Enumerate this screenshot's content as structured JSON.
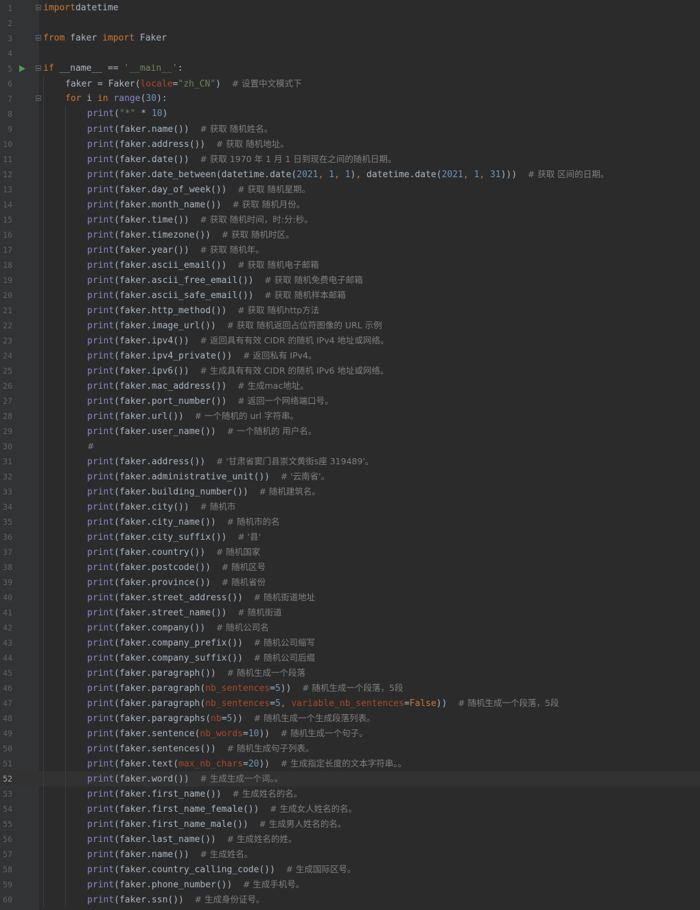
{
  "editor": {
    "current_line": 52,
    "run_marker_line": 5,
    "fold_lines": [
      1,
      3,
      5,
      7
    ],
    "colors": {
      "background": "#2b2b2b",
      "gutter": "#313335",
      "keyword": "#cc7832",
      "string": "#6a8759",
      "number": "#6897bb",
      "builtin": "#8888c6",
      "parameter": "#aa4926",
      "comment": "#808080",
      "text": "#a9b7c6",
      "run_marker": "#499c54"
    },
    "lines": [
      {
        "n": 1,
        "i": 0,
        "t": [
          [
            "kw",
            "import"
          ],
          [
            "",
            "datetime"
          ]
        ],
        "sp": [
          0,
          1
        ]
      },
      {
        "n": 2,
        "i": 0,
        "t": []
      },
      {
        "n": 3,
        "i": 0,
        "t": [
          [
            "kw",
            "from"
          ],
          [
            "",
            " faker "
          ],
          [
            "kw",
            "import"
          ],
          [
            "",
            " Faker"
          ]
        ]
      },
      {
        "n": 4,
        "i": 0,
        "t": []
      },
      {
        "n": 5,
        "i": 0,
        "t": [
          [
            "kw",
            "if"
          ],
          [
            "",
            " __name__ == "
          ],
          [
            "str",
            "'__main__'"
          ],
          [
            "",
            ":"
          ]
        ]
      },
      {
        "n": 6,
        "i": 1,
        "t": [
          [
            "",
            "faker = Faker("
          ],
          [
            "par",
            "locale"
          ],
          [
            "",
            "="
          ],
          [
            "str",
            "\"zh_CN\""
          ],
          [
            "",
            ")  "
          ],
          [
            "cm",
            "# 设置中文模式下"
          ]
        ]
      },
      {
        "n": 7,
        "i": 1,
        "t": [
          [
            "kw",
            "for"
          ],
          [
            "",
            " i "
          ],
          [
            "kw",
            "in"
          ],
          [
            "",
            " "
          ],
          [
            "bi",
            "range"
          ],
          [
            "",
            "("
          ],
          [
            "num",
            "30"
          ],
          [
            "",
            "):"
          ]
        ]
      },
      {
        "n": 8,
        "i": 2,
        "t": [
          [
            "bi",
            "print"
          ],
          [
            "",
            "("
          ],
          [
            "str",
            "\"*\""
          ],
          [
            "",
            " * "
          ],
          [
            "num",
            "10"
          ],
          [
            "",
            ")"
          ]
        ]
      },
      {
        "n": 9,
        "i": 2,
        "t": [
          [
            "bi",
            "print"
          ],
          [
            "",
            "(faker.name())  "
          ],
          [
            "cm",
            "# 获取 随机姓名。"
          ]
        ]
      },
      {
        "n": 10,
        "i": 2,
        "t": [
          [
            "bi",
            "print"
          ],
          [
            "",
            "(faker.address())  "
          ],
          [
            "cm",
            "# 获取 随机地址。"
          ]
        ]
      },
      {
        "n": 11,
        "i": 2,
        "t": [
          [
            "bi",
            "print"
          ],
          [
            "",
            "(faker.date())  "
          ],
          [
            "cm",
            "# 获取 1970 年 1 月 1 日到现在之间的随机日期。"
          ]
        ]
      },
      {
        "n": 12,
        "i": 2,
        "t": [
          [
            "bi",
            "print"
          ],
          [
            "",
            "(faker.date_between(datetime.date("
          ],
          [
            "num",
            "2021"
          ],
          [
            "kw",
            ", "
          ],
          [
            "num",
            "1"
          ],
          [
            "kw",
            ", "
          ],
          [
            "num",
            "1"
          ],
          [
            "",
            ")"
          ],
          [
            "kw",
            ", "
          ],
          [
            "",
            "datetime.date("
          ],
          [
            "num",
            "2021"
          ],
          [
            "kw",
            ", "
          ],
          [
            "num",
            "1"
          ],
          [
            "kw",
            ", "
          ],
          [
            "num",
            "31"
          ],
          [
            "",
            ")))  "
          ],
          [
            "cm",
            "# 获取 区间的日期。"
          ]
        ]
      },
      {
        "n": 13,
        "i": 2,
        "t": [
          [
            "bi",
            "print"
          ],
          [
            "",
            "(faker.day_of_week())  "
          ],
          [
            "cm",
            "# 获取 随机星期。"
          ]
        ]
      },
      {
        "n": 14,
        "i": 2,
        "t": [
          [
            "bi",
            "print"
          ],
          [
            "",
            "(faker.month_name())  "
          ],
          [
            "cm",
            "# 获取 随机月份。"
          ]
        ]
      },
      {
        "n": 15,
        "i": 2,
        "t": [
          [
            "bi",
            "print"
          ],
          [
            "",
            "(faker.time())  "
          ],
          [
            "cm",
            "# 获取 随机时间，时:分:秒。"
          ]
        ]
      },
      {
        "n": 16,
        "i": 2,
        "t": [
          [
            "bi",
            "print"
          ],
          [
            "",
            "(faker.timezone())  "
          ],
          [
            "cm",
            "# 获取 随机时区。"
          ]
        ]
      },
      {
        "n": 17,
        "i": 2,
        "t": [
          [
            "bi",
            "print"
          ],
          [
            "",
            "(faker.year())  "
          ],
          [
            "cm",
            "# 获取 随机年。"
          ]
        ]
      },
      {
        "n": 18,
        "i": 2,
        "t": [
          [
            "bi",
            "print"
          ],
          [
            "",
            "(faker.ascii_email())  "
          ],
          [
            "cm",
            "# 获取 随机电子邮箱"
          ]
        ]
      },
      {
        "n": 19,
        "i": 2,
        "t": [
          [
            "bi",
            "print"
          ],
          [
            "",
            "(faker.ascii_free_email())  "
          ],
          [
            "cm",
            "# 获取 随机免费电子邮箱"
          ]
        ]
      },
      {
        "n": 20,
        "i": 2,
        "t": [
          [
            "bi",
            "print"
          ],
          [
            "",
            "(faker.ascii_safe_email())  "
          ],
          [
            "cm",
            "# 获取 随机样本邮箱"
          ]
        ]
      },
      {
        "n": 21,
        "i": 2,
        "t": [
          [
            "bi",
            "print"
          ],
          [
            "",
            "(faker.http_method())  "
          ],
          [
            "cm",
            "# 获取 随机http方法"
          ]
        ]
      },
      {
        "n": 22,
        "i": 2,
        "t": [
          [
            "bi",
            "print"
          ],
          [
            "",
            "(faker.image_url())  "
          ],
          [
            "cm",
            "# 获取 随机返回占位符图像的 URL 示例"
          ]
        ]
      },
      {
        "n": 23,
        "i": 2,
        "t": [
          [
            "bi",
            "print"
          ],
          [
            "",
            "(faker.ipv4())  "
          ],
          [
            "cm",
            "# 返回具有有效 CIDR 的随机 IPv4 地址或网络。"
          ]
        ]
      },
      {
        "n": 24,
        "i": 2,
        "t": [
          [
            "bi",
            "print"
          ],
          [
            "",
            "(faker.ipv4_private())  "
          ],
          [
            "cm",
            "# 返回私有 IPv4。"
          ]
        ]
      },
      {
        "n": 25,
        "i": 2,
        "t": [
          [
            "bi",
            "print"
          ],
          [
            "",
            "(faker.ipv6())  "
          ],
          [
            "cm",
            "# 生成具有有效 CIDR 的随机 IPv6 地址或网络。"
          ]
        ]
      },
      {
        "n": 26,
        "i": 2,
        "t": [
          [
            "bi",
            "print"
          ],
          [
            "",
            "(faker.mac_address())  "
          ],
          [
            "cm",
            "# 生成mac地址。"
          ]
        ]
      },
      {
        "n": 27,
        "i": 2,
        "t": [
          [
            "bi",
            "print"
          ],
          [
            "",
            "(faker.port_number())  "
          ],
          [
            "cm",
            "# 返回一个网络端口号。"
          ]
        ]
      },
      {
        "n": 28,
        "i": 2,
        "t": [
          [
            "bi",
            "print"
          ],
          [
            "",
            "(faker.url())  "
          ],
          [
            "cm",
            "# 一个随机的 url 字符串。"
          ]
        ]
      },
      {
        "n": 29,
        "i": 2,
        "t": [
          [
            "bi",
            "print"
          ],
          [
            "",
            "(faker.user_name())  "
          ],
          [
            "cm",
            "# 一个随机的 用户名。"
          ]
        ]
      },
      {
        "n": 30,
        "i": 2,
        "t": [
          [
            "cm",
            "#"
          ]
        ]
      },
      {
        "n": 31,
        "i": 2,
        "t": [
          [
            "bi",
            "print"
          ],
          [
            "",
            "(faker.address())  "
          ],
          [
            "cm",
            "# '甘肃省窦门县崇文黄街s座 319489'。"
          ]
        ]
      },
      {
        "n": 32,
        "i": 2,
        "t": [
          [
            "bi",
            "print"
          ],
          [
            "",
            "(faker.administrative_unit())  "
          ],
          [
            "cm",
            "# '云南省'。"
          ]
        ]
      },
      {
        "n": 33,
        "i": 2,
        "t": [
          [
            "bi",
            "print"
          ],
          [
            "",
            "(faker.building_number())  "
          ],
          [
            "cm",
            "# 随机建筑名。"
          ]
        ]
      },
      {
        "n": 34,
        "i": 2,
        "t": [
          [
            "bi",
            "print"
          ],
          [
            "",
            "(faker.city())  "
          ],
          [
            "cm",
            "# 随机市"
          ]
        ]
      },
      {
        "n": 35,
        "i": 2,
        "t": [
          [
            "bi",
            "print"
          ],
          [
            "",
            "(faker.city_name())  "
          ],
          [
            "cm",
            "# 随机市的名"
          ]
        ]
      },
      {
        "n": 36,
        "i": 2,
        "t": [
          [
            "bi",
            "print"
          ],
          [
            "",
            "(faker.city_suffix())  "
          ],
          [
            "cm",
            "# '县'"
          ]
        ]
      },
      {
        "n": 37,
        "i": 2,
        "t": [
          [
            "bi",
            "print"
          ],
          [
            "",
            "(faker.country())  "
          ],
          [
            "cm",
            "# 随机国家"
          ]
        ]
      },
      {
        "n": 38,
        "i": 2,
        "t": [
          [
            "bi",
            "print"
          ],
          [
            "",
            "(faker.postcode())  "
          ],
          [
            "cm",
            "# 随机区号"
          ]
        ]
      },
      {
        "n": 39,
        "i": 2,
        "t": [
          [
            "bi",
            "print"
          ],
          [
            "",
            "(faker.province())  "
          ],
          [
            "cm",
            "# 随机省份"
          ]
        ]
      },
      {
        "n": 40,
        "i": 2,
        "t": [
          [
            "bi",
            "print"
          ],
          [
            "",
            "(faker.street_address())  "
          ],
          [
            "cm",
            "# 随机街道地址"
          ]
        ]
      },
      {
        "n": 41,
        "i": 2,
        "t": [
          [
            "bi",
            "print"
          ],
          [
            "",
            "(faker.street_name())  "
          ],
          [
            "cm",
            "# 随机街道"
          ]
        ]
      },
      {
        "n": 42,
        "i": 2,
        "t": [
          [
            "bi",
            "print"
          ],
          [
            "",
            "(faker.company())  "
          ],
          [
            "cm",
            "# 随机公司名"
          ]
        ]
      },
      {
        "n": 43,
        "i": 2,
        "t": [
          [
            "bi",
            "print"
          ],
          [
            "",
            "(faker.company_prefix())  "
          ],
          [
            "cm",
            "# 随机公司缩写"
          ]
        ]
      },
      {
        "n": 44,
        "i": 2,
        "t": [
          [
            "bi",
            "print"
          ],
          [
            "",
            "(faker.company_suffix())  "
          ],
          [
            "cm",
            "# 随机公司后缀"
          ]
        ]
      },
      {
        "n": 45,
        "i": 2,
        "t": [
          [
            "bi",
            "print"
          ],
          [
            "",
            "(faker.paragraph())  "
          ],
          [
            "cm",
            "# 随机生成一个段落"
          ]
        ]
      },
      {
        "n": 46,
        "i": 2,
        "t": [
          [
            "bi",
            "print"
          ],
          [
            "",
            "(faker.paragraph("
          ],
          [
            "par",
            "nb_sentences"
          ],
          [
            "",
            "="
          ],
          [
            "num",
            "5"
          ],
          [
            "",
            "))  "
          ],
          [
            "cm",
            "# 随机生成一个段落，5段"
          ]
        ]
      },
      {
        "n": 47,
        "i": 2,
        "t": [
          [
            "bi",
            "print"
          ],
          [
            "",
            "(faker.paragraph("
          ],
          [
            "par",
            "nb_sentences"
          ],
          [
            "",
            "="
          ],
          [
            "num",
            "5"
          ],
          [
            "kw",
            ", "
          ],
          [
            "par",
            "variable_nb_sentences"
          ],
          [
            "",
            "="
          ],
          [
            "kw",
            "False"
          ],
          [
            "",
            "))  "
          ],
          [
            "cm",
            "# 随机生成一个段落，5段"
          ]
        ]
      },
      {
        "n": 48,
        "i": 2,
        "t": [
          [
            "bi",
            "print"
          ],
          [
            "",
            "(faker.paragraphs("
          ],
          [
            "par",
            "nb"
          ],
          [
            "",
            "="
          ],
          [
            "num",
            "5"
          ],
          [
            "",
            "))  "
          ],
          [
            "cm",
            "# 随机生成一个生成段落列表。"
          ]
        ]
      },
      {
        "n": 49,
        "i": 2,
        "t": [
          [
            "bi",
            "print"
          ],
          [
            "",
            "(faker.sentence("
          ],
          [
            "par",
            "nb_words"
          ],
          [
            "",
            "="
          ],
          [
            "num",
            "10"
          ],
          [
            "",
            "))  "
          ],
          [
            "cm",
            "# 随机生成一个句子。"
          ]
        ]
      },
      {
        "n": 50,
        "i": 2,
        "t": [
          [
            "bi",
            "print"
          ],
          [
            "",
            "(faker.sentences())  "
          ],
          [
            "cm",
            "# 随机生成句子列表。"
          ]
        ]
      },
      {
        "n": 51,
        "i": 2,
        "t": [
          [
            "bi",
            "print"
          ],
          [
            "",
            "(faker.text("
          ],
          [
            "par",
            "max_nb_chars"
          ],
          [
            "",
            "="
          ],
          [
            "num",
            "20"
          ],
          [
            "",
            "))  "
          ],
          [
            "cm",
            "# 生成指定长度的文本字符串。。"
          ]
        ]
      },
      {
        "n": 52,
        "i": 2,
        "t": [
          [
            "bi",
            "print"
          ],
          [
            "",
            "(faker.word())  "
          ],
          [
            "cm",
            "# 生成生成一个词。。"
          ]
        ]
      },
      {
        "n": 53,
        "i": 2,
        "t": [
          [
            "bi",
            "print"
          ],
          [
            "",
            "(faker.first_name())  "
          ],
          [
            "cm",
            "# 生成姓名的名。"
          ]
        ]
      },
      {
        "n": 54,
        "i": 2,
        "t": [
          [
            "bi",
            "print"
          ],
          [
            "",
            "(faker.first_name_female())  "
          ],
          [
            "cm",
            "# 生成女人姓名的名。"
          ]
        ]
      },
      {
        "n": 55,
        "i": 2,
        "t": [
          [
            "bi",
            "print"
          ],
          [
            "",
            "(faker.first_name_male())  "
          ],
          [
            "cm",
            "# 生成男人姓名的名。"
          ]
        ]
      },
      {
        "n": 56,
        "i": 2,
        "t": [
          [
            "bi",
            "print"
          ],
          [
            "",
            "(faker.last_name())  "
          ],
          [
            "cm",
            "# 生成姓名的姓。"
          ]
        ]
      },
      {
        "n": 57,
        "i": 2,
        "t": [
          [
            "bi",
            "print"
          ],
          [
            "",
            "(faker.name())  "
          ],
          [
            "cm",
            "# 生成姓名。"
          ]
        ]
      },
      {
        "n": 58,
        "i": 2,
        "t": [
          [
            "bi",
            "print"
          ],
          [
            "",
            "(faker.country_calling_code())  "
          ],
          [
            "cm",
            "# 生成国际区号。"
          ]
        ]
      },
      {
        "n": 59,
        "i": 2,
        "t": [
          [
            "bi",
            "print"
          ],
          [
            "",
            "(faker.phone_number())  "
          ],
          [
            "cm",
            "# 生成手机号。"
          ]
        ]
      },
      {
        "n": 60,
        "i": 2,
        "t": [
          [
            "bi",
            "print"
          ],
          [
            "",
            "(faker.ssn())  "
          ],
          [
            "cm",
            "# 生成身份证号。"
          ]
        ]
      }
    ]
  }
}
